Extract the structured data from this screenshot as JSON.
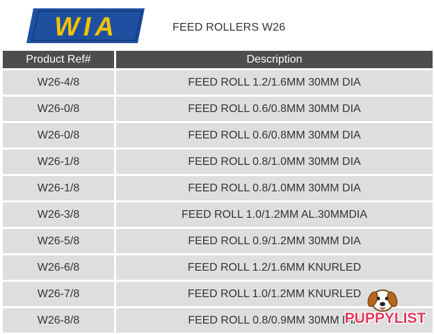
{
  "header": {
    "logo_text": "WIA",
    "title": "FEED ROLLERS W26"
  },
  "table": {
    "columns": [
      "Product Ref#",
      "Description"
    ],
    "rows": [
      {
        "ref": "W26-4/8",
        "description": "FEED ROLL 1.2/1.6MM 30MM DIA"
      },
      {
        "ref": "W26-0/8",
        "description": "FEED ROLL 0.6/0.8MM 30MM DIA"
      },
      {
        "ref": "W26-0/8",
        "description": "FEED ROLL 0.6/0.8MM 30MM DIA"
      },
      {
        "ref": "W26-1/8",
        "description": "FEED ROLL 0.8/1.0MM 30MM DIA"
      },
      {
        "ref": "W26-1/8",
        "description": "FEED ROLL 0.8/1.0MM 30MM DIA"
      },
      {
        "ref": "W26-3/8",
        "description": "FEED ROLL 1.0/1.2MM AL.30MMDIA"
      },
      {
        "ref": "W26-5/8",
        "description": "FEED ROLL 0.9/1.2MM 30MM DIA"
      },
      {
        "ref": "W26-6/8",
        "description": "FEED ROLL 1.2/1.6MM KNURLED"
      },
      {
        "ref": "W26-7/8",
        "description": "FEED ROLL 1.0/1.2MM KNURLED"
      },
      {
        "ref": "W26-8/8",
        "description": "FEED ROLL 0.8/0.9MM 30MM DIA"
      }
    ]
  },
  "watermark": {
    "text": "PUPPYLIST"
  },
  "colors": {
    "logo_blue": "#1f4fa0",
    "logo_yellow": "#f2c200",
    "header_bg": "#4d4d4d",
    "row_bg": "#dedede",
    "text": "#333333"
  }
}
